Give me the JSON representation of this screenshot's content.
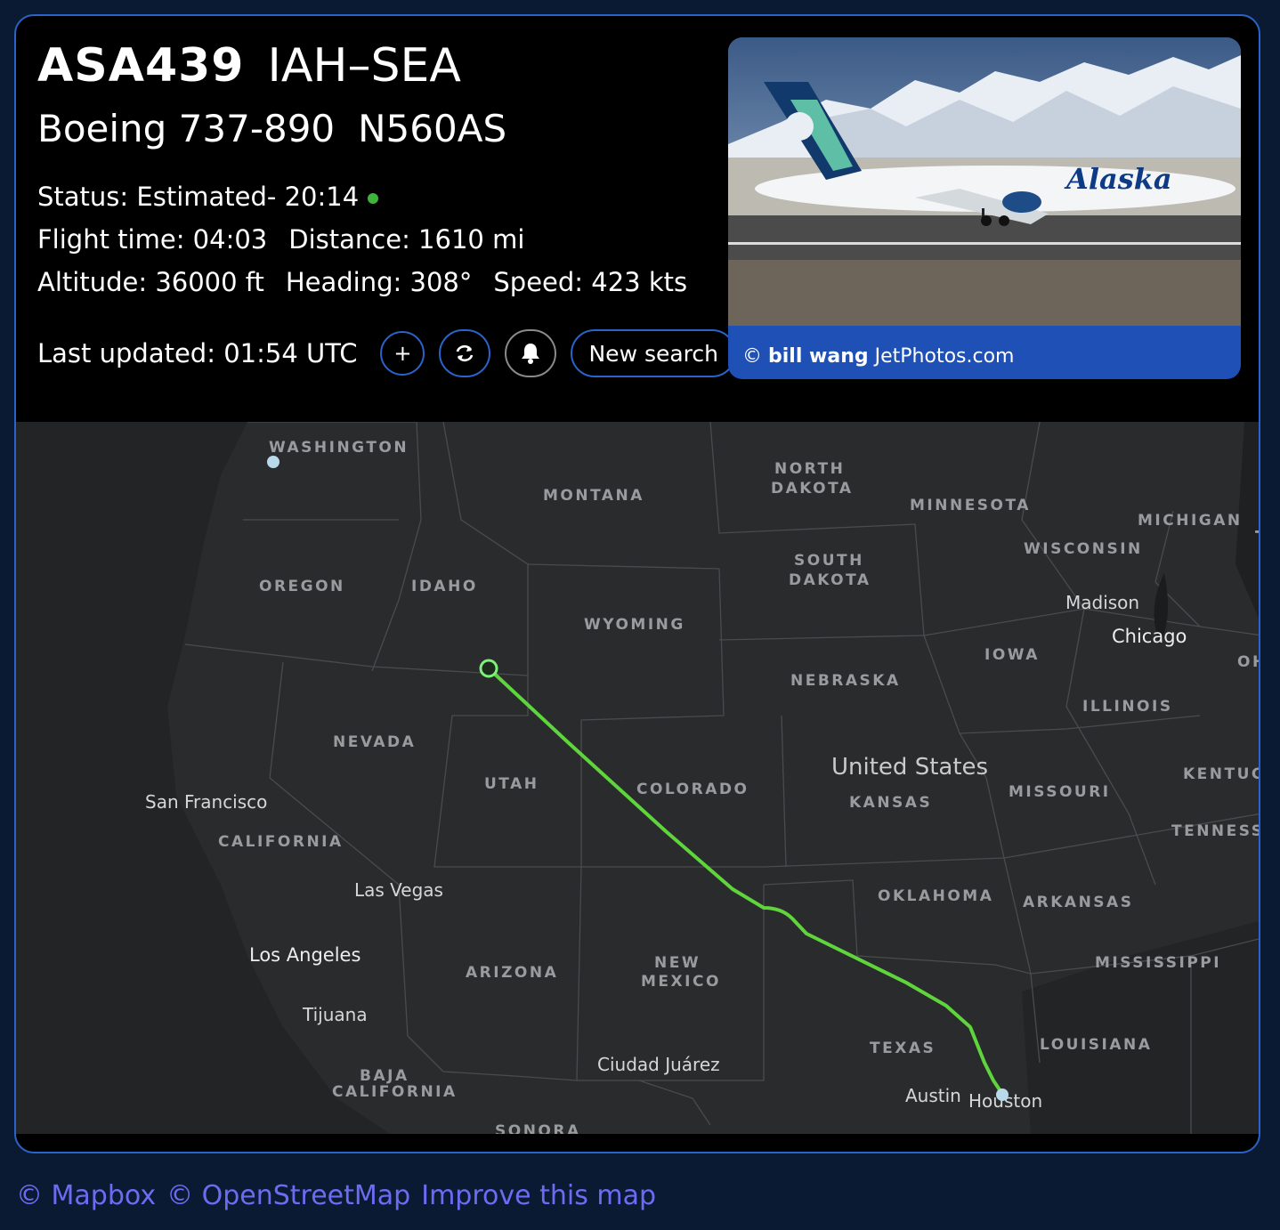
{
  "flight": {
    "callsign": "ASA439",
    "route": "IAH–SEA",
    "aircraft_type": "Boeing 737-890",
    "registration": "N560AS"
  },
  "stats": {
    "status": "Status: Estimated- 20:14",
    "flight_time": "Flight time: 04:03",
    "distance": "Distance: 1610 mi",
    "altitude": "Altitude: 36000 ft",
    "heading": "Heading: 308°",
    "speed": "Speed: 423 kts",
    "status_color": "#3fb43a"
  },
  "actions": {
    "last_updated": "Last updated: 01:54 UTC",
    "add_label": "+",
    "refresh_icon": "refresh-icon",
    "bell_icon": "bell-icon",
    "new_search_label": "New search"
  },
  "photo": {
    "credit_symbol": "©",
    "photographer": "bill wang",
    "source": "JetPhotos.com",
    "airline_livery_text": "Alaska"
  },
  "map": {
    "states": [
      "WASHINGTON",
      "MONTANA",
      "NORTH",
      "DAKOTA",
      "MINNESOTA",
      "MICHIGAN",
      "WISCONSIN",
      "OREGON",
      "IDAHO",
      "SOUTH",
      "DAKOTA",
      "WYOMING",
      "IOWA",
      "NEBRASKA",
      "NEVADA",
      "UTAH",
      "COLORADO",
      "ILLINOIS",
      "KANSAS",
      "MISSOURI",
      "CALIFORNIA",
      "OKLAHOMA",
      "ARKANSAS",
      "ARIZONA",
      "NEW",
      "MEXICO",
      "MISSISSIPPI",
      "TEXAS",
      "LOUISIANA",
      "BAJA",
      "CALIFORNIA",
      "SONORA",
      "OH",
      "KENTUCK",
      "TENNESSE",
      "T"
    ],
    "cities": [
      "Madison",
      "Chicago",
      "San Francisco",
      "Las Vegas",
      "Los Angeles",
      "Tijuana",
      "Ciudad Juárez",
      "Austin",
      "Houston"
    ],
    "country": "United States",
    "track_color": "#5ed53a",
    "aircraft_marker_color": "#7ef07a",
    "airport_marker_color": "#b9d8ea"
  },
  "attribution": {
    "mapbox": "© Mapbox",
    "osm": "© OpenStreetMap",
    "improve": "Improve this map",
    "color": "#6c6cf2"
  }
}
